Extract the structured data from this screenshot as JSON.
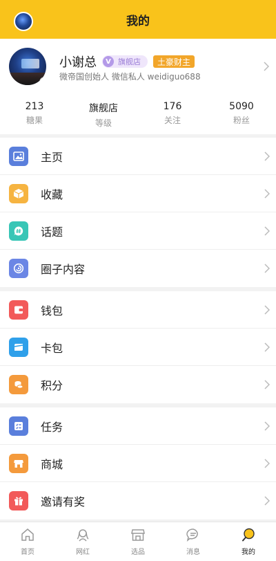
{
  "header": {
    "title": "我的"
  },
  "profile": {
    "name": "小谢总",
    "verified_badge": "V",
    "store_tag": "旗舰店",
    "rank_tag": "土豪财主",
    "bio": "微帝国创始人 微信私人 weidiguo688"
  },
  "stats": [
    {
      "value": "213",
      "label": "糖果"
    },
    {
      "value": "旗舰店",
      "label": "等级"
    },
    {
      "value": "176",
      "label": "关注"
    },
    {
      "value": "5090",
      "label": "粉丝"
    }
  ],
  "menu_groups": [
    [
      {
        "label": "主页",
        "icon": "image-icon",
        "color": "#5a7fdc"
      },
      {
        "label": "收藏",
        "icon": "box-icon",
        "color": "#f6b441"
      },
      {
        "label": "话题",
        "icon": "hashtag-chat-icon",
        "color": "#38c6b6"
      },
      {
        "label": "圈子内容",
        "icon": "circle-swirl-icon",
        "color": "#6b86e5"
      }
    ],
    [
      {
        "label": "钱包",
        "icon": "wallet-icon",
        "color": "#f25a5a"
      },
      {
        "label": "卡包",
        "icon": "card-icon",
        "color": "#2fa0ea"
      },
      {
        "label": "积分",
        "icon": "coins-icon",
        "color": "#f49a3c"
      }
    ],
    [
      {
        "label": "任务",
        "icon": "task-list-icon",
        "color": "#5a7fdc"
      },
      {
        "label": "商城",
        "icon": "store-icon",
        "color": "#f49a3c"
      },
      {
        "label": "邀请有奖",
        "icon": "gift-icon",
        "color": "#f25a5a"
      }
    ]
  ],
  "tabbar": [
    {
      "label": "首页",
      "icon": "home-icon",
      "active": false
    },
    {
      "label": "网红",
      "icon": "influencer-icon",
      "active": false
    },
    {
      "label": "选品",
      "icon": "shop-icon",
      "active": false
    },
    {
      "label": "消息",
      "icon": "message-icon",
      "active": false
    },
    {
      "label": "我的",
      "icon": "profile-icon",
      "active": true
    }
  ],
  "colors": {
    "accent": "#f9c31b",
    "background": "#f2f2f2"
  }
}
